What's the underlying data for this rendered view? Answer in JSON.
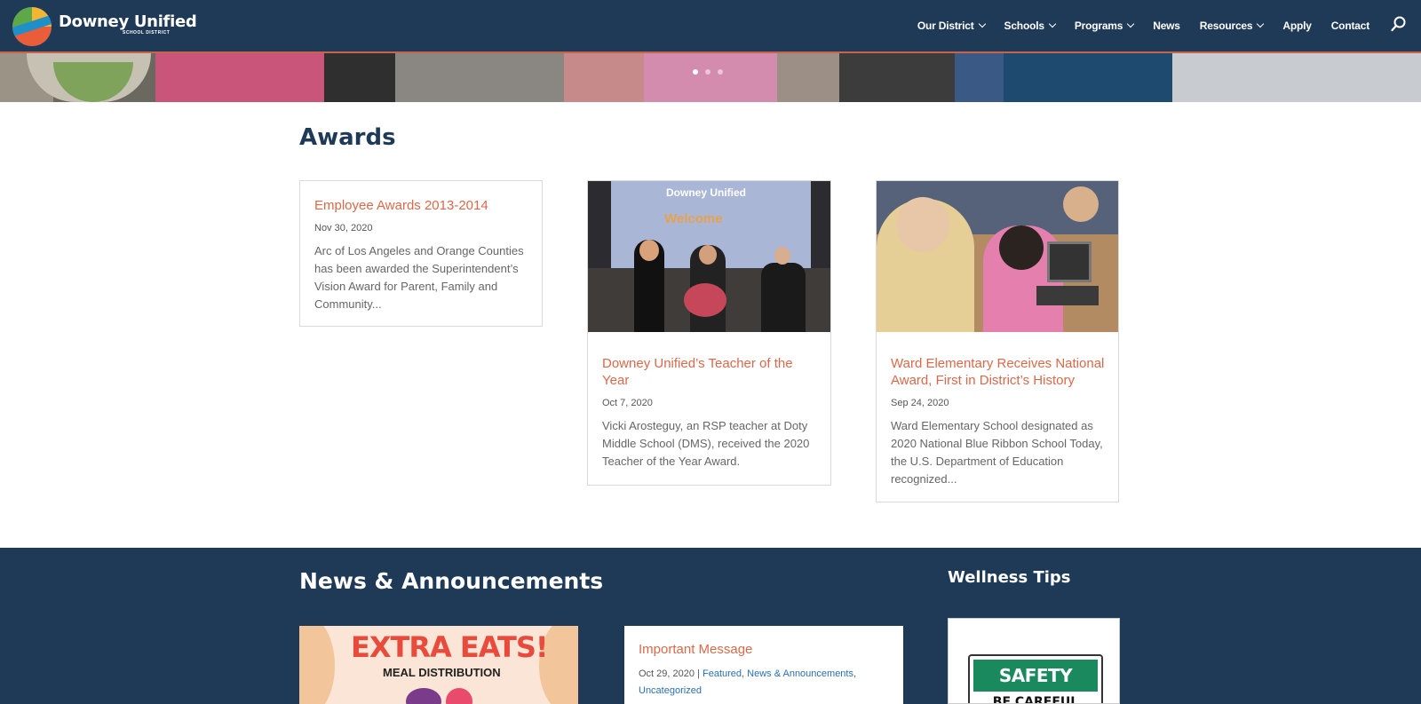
{
  "brand": {
    "name": "Downey Unified",
    "sub": "SCHOOL DISTRICT"
  },
  "nav": {
    "items": [
      {
        "label": "Our District",
        "dropdown": true
      },
      {
        "label": "Schools",
        "dropdown": true
      },
      {
        "label": "Programs",
        "dropdown": true
      },
      {
        "label": "News",
        "dropdown": false
      },
      {
        "label": "Resources",
        "dropdown": true
      },
      {
        "label": "Apply",
        "dropdown": false
      },
      {
        "label": "Contact",
        "dropdown": false
      }
    ],
    "search_icon": "search-icon"
  },
  "slider": {
    "count": 3,
    "active": 0
  },
  "awards": {
    "title": "Awards",
    "cards": [
      {
        "title": "Employee Awards 2013-2014",
        "date": "Nov 30, 2020",
        "excerpt": "Arc of Los Angeles and Orange Counties has been awarded the Superintendent’s Vision Award for Parent, Family and Community..."
      },
      {
        "title": "Downey Unified’s Teacher of the Year",
        "date": "Oct 7, 2020",
        "excerpt": "Vicki Arosteguy, an RSP teacher at Doty Middle School (DMS), received the 2020 Teacher of the Year Award.",
        "image_text": {
          "logo": "Downey Unified",
          "welcome": "Welcome"
        }
      },
      {
        "title": "Ward Elementary Receives National Award, First in District’s History",
        "date": "Sep 24, 2020",
        "excerpt": "Ward Elementary School designated as 2020 National Blue Ribbon School Today, the U.S. Department of Education recognized..."
      }
    ]
  },
  "news": {
    "title": "News & Announcements",
    "promo": {
      "headline": "EXTRA EATS!",
      "sub": "MEAL DISTRIBUTION"
    },
    "post": {
      "title": "Important Message",
      "date": "Oct 29, 2020",
      "separator": " | ",
      "categories": [
        "Featured",
        "News & Announcements",
        "Uncategorized"
      ]
    }
  },
  "wellness": {
    "title": "Wellness Tips",
    "sign_top": "SAFETY FIRST",
    "sign_bottom": "BE CAREFUL"
  },
  "colors": {
    "header_bg": "#1f3a57",
    "accent": "#d9694a",
    "link": "#2a6fb2"
  }
}
